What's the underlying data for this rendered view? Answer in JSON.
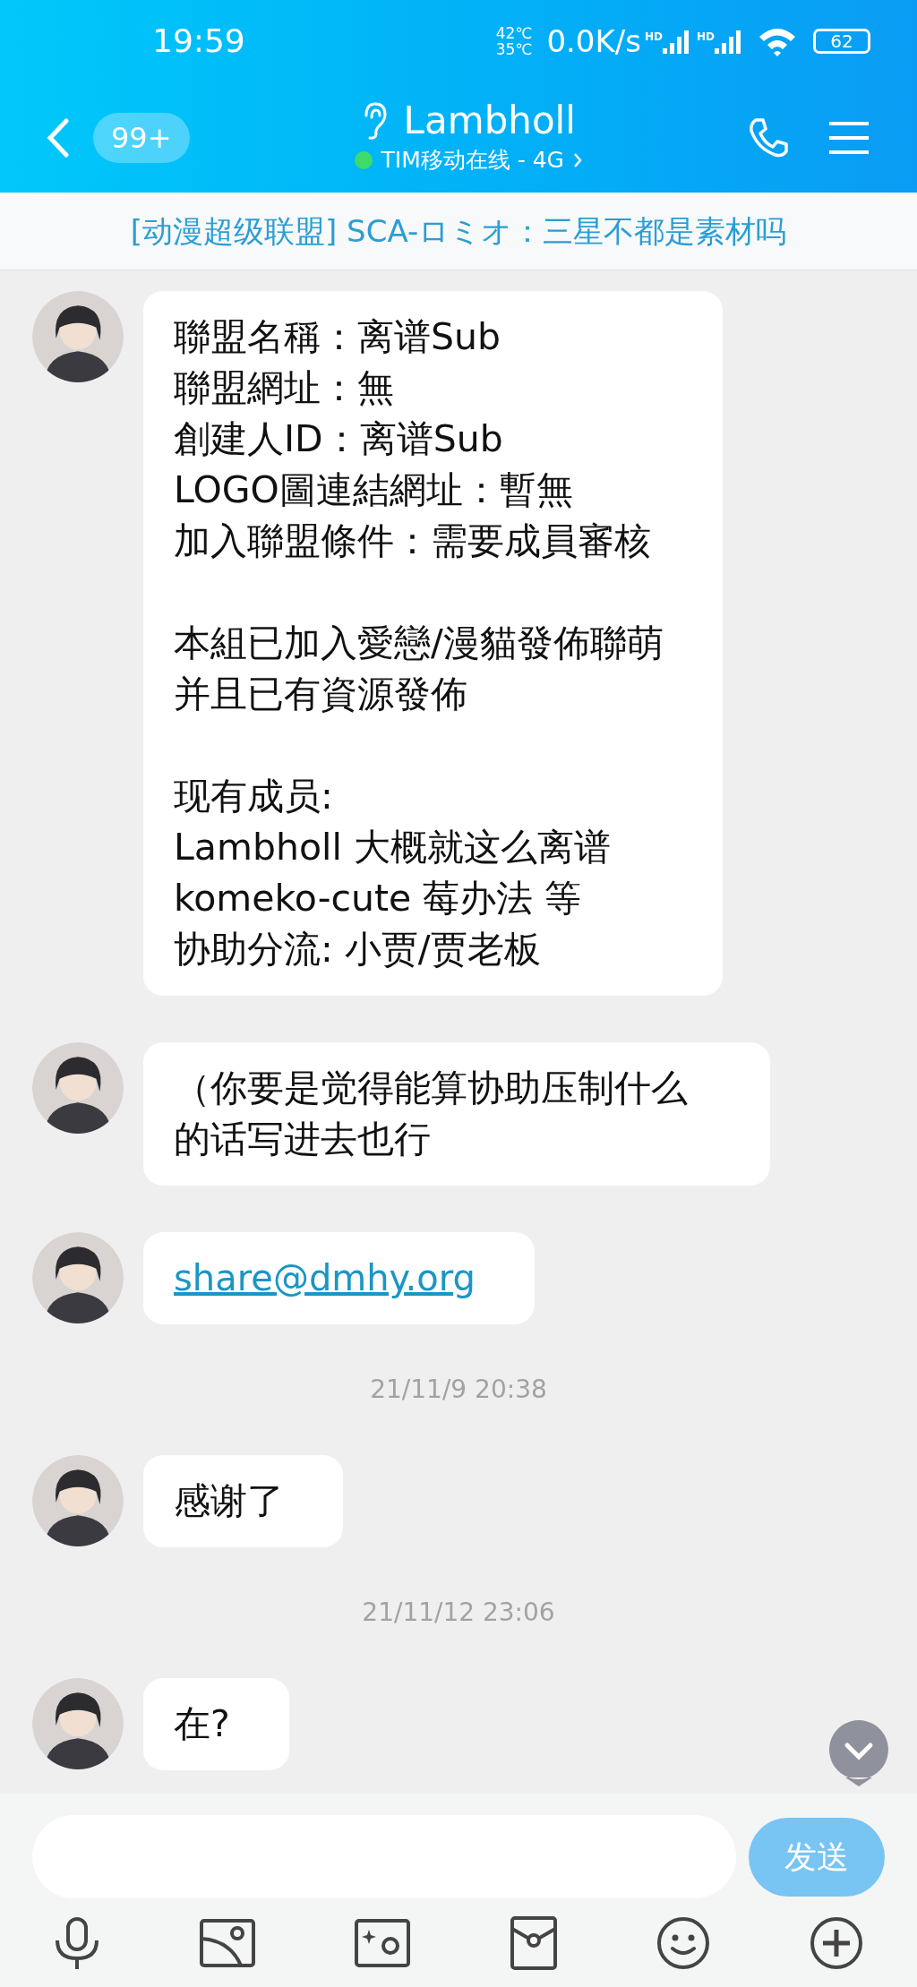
{
  "status_bar": {
    "time": "19:59",
    "temps": [
      "42℃",
      "35℃"
    ],
    "speed": "0.0K/s",
    "sim_labels": [
      "HD",
      "HD"
    ],
    "battery": "62"
  },
  "header": {
    "back_count": "99+",
    "title": "Lambholl",
    "status": "TIM移动在线 - 4G",
    "online": true
  },
  "banner": {
    "text": "[动漫超级联盟] SCA-ロミオ：三星不都是素材吗"
  },
  "messages": [
    {
      "kind": "text",
      "paragraphs": [
        [
          "聯盟名稱：离谱Sub",
          "聯盟網址：無",
          "創建人ID：离谱Sub",
          "LOGO圖連結網址：暫無",
          "加入聯盟條件：需要成員審核"
        ],
        [
          "本組已加入愛戀/漫貓發佈聯萌",
          "并且已有資源發佈"
        ],
        [
          "现有成员:",
          "Lambholl 大概就这么离谱",
          "komeko-cute 莓办法 等",
          "协助分流: 小贾/贾老板"
        ]
      ]
    },
    {
      "kind": "text",
      "paragraphs": [
        [
          "（你要是觉得能算协助压制什么的话写进去也行"
        ]
      ]
    },
    {
      "kind": "link",
      "text": "share@dmhy.org"
    },
    {
      "kind": "time",
      "text": "21/11/9 20:38"
    },
    {
      "kind": "text",
      "paragraphs": [
        [
          "感谢了"
        ]
      ]
    },
    {
      "kind": "time",
      "text": "21/11/12 23:06"
    },
    {
      "kind": "text",
      "paragraphs": [
        [
          "在?"
        ]
      ]
    }
  ],
  "composer": {
    "send": "发送"
  }
}
